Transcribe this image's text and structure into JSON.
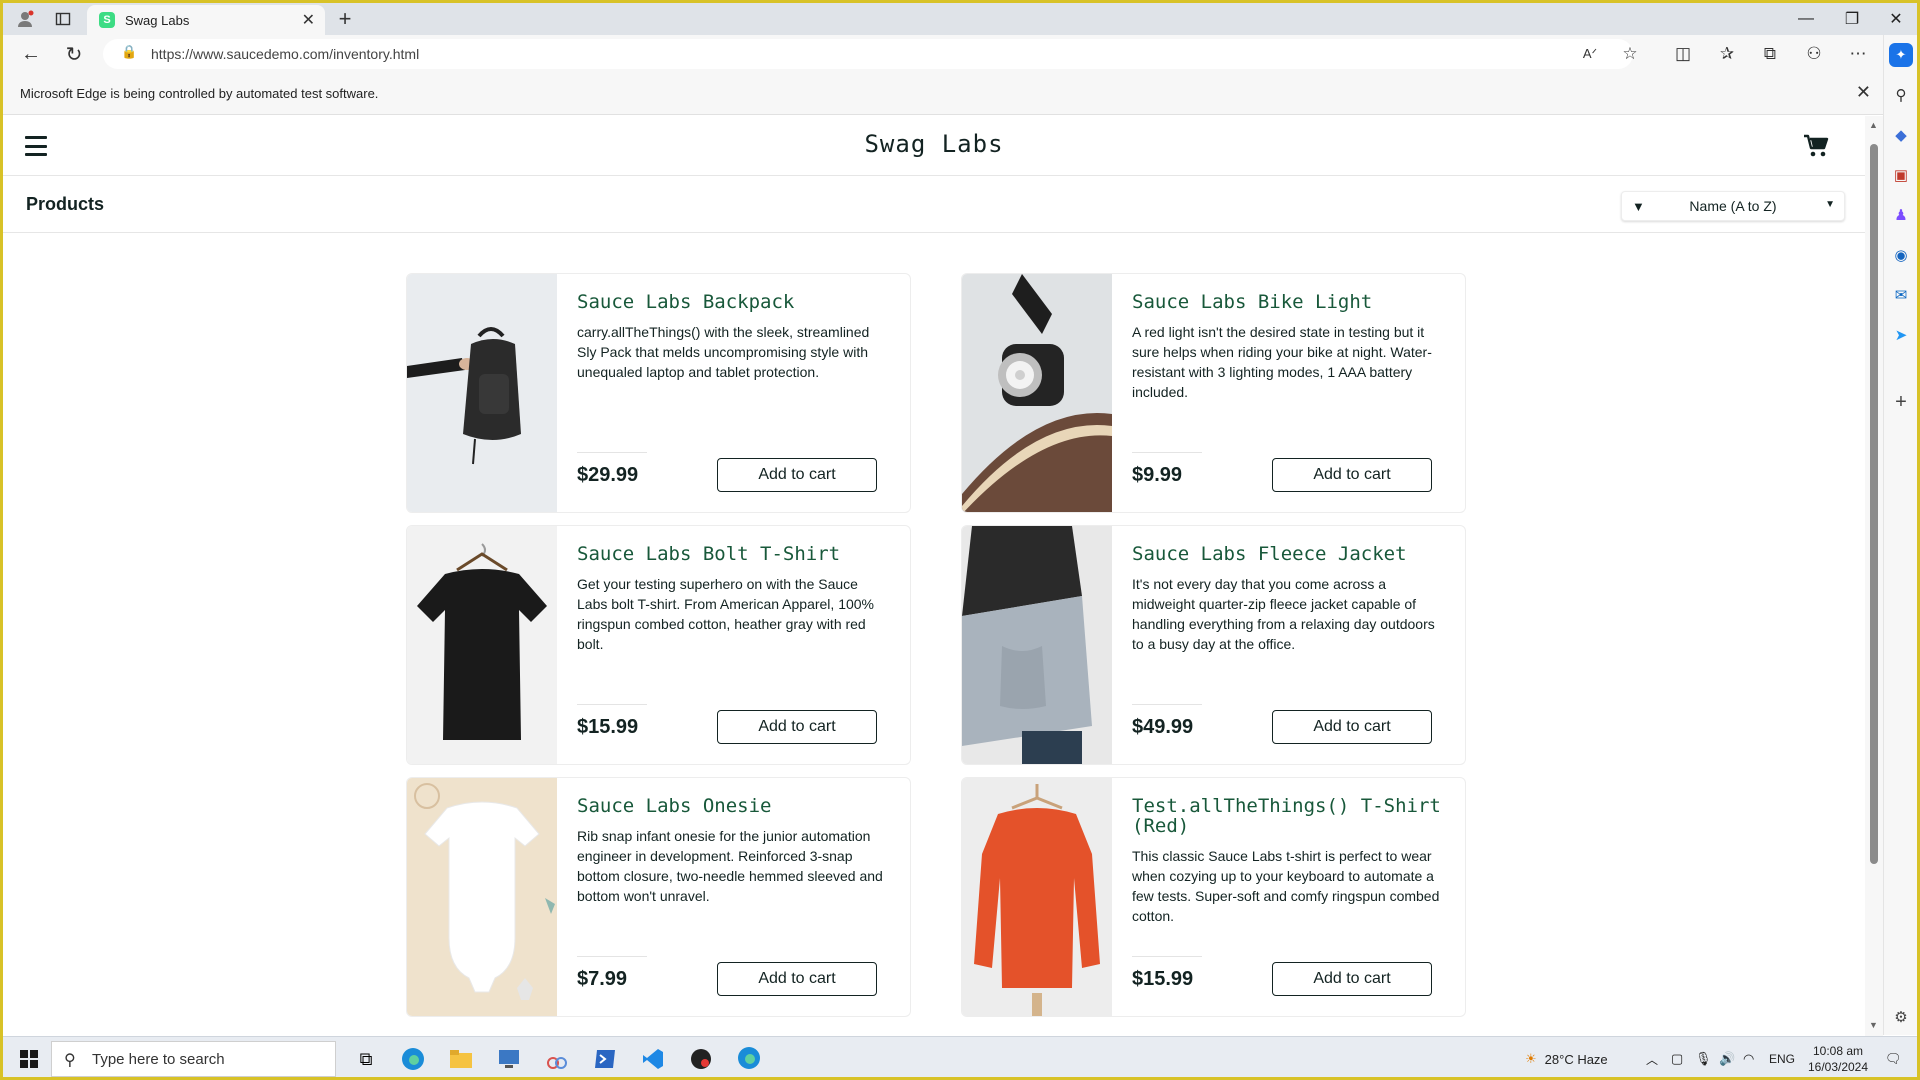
{
  "browser": {
    "tab_title": "Swag Labs",
    "url": "https://www.saucedemo.com/inventory.html",
    "automation_notice": "Microsoft Edge is being controlled by automated test software.",
    "favicon_letter": "S"
  },
  "app": {
    "logo": "Swag Labs",
    "page_title": "Products",
    "sort_selected": "Name (A to Z)"
  },
  "products": [
    {
      "name": "Sauce Labs Backpack",
      "description": "carry.allTheThings() with the sleek, streamlined Sly Pack that melds uncompromising style with unequaled laptop and tablet protection.",
      "price": "$29.99",
      "button": "Add to cart"
    },
    {
      "name": "Sauce Labs Bike Light",
      "description": "A red light isn't the desired state in testing but it sure helps when riding your bike at night. Water-resistant with 3 lighting modes, 1 AAA battery included.",
      "price": "$9.99",
      "button": "Add to cart"
    },
    {
      "name": "Sauce Labs Bolt T-Shirt",
      "description": "Get your testing superhero on with the Sauce Labs bolt T-shirt. From American Apparel, 100% ringspun combed cotton, heather gray with red bolt.",
      "price": "$15.99",
      "button": "Add to cart"
    },
    {
      "name": "Sauce Labs Fleece Jacket",
      "description": "It's not every day that you come across a midweight quarter-zip fleece jacket capable of handling everything from a relaxing day outdoors to a busy day at the office.",
      "price": "$49.99",
      "button": "Add to cart"
    },
    {
      "name": "Sauce Labs Onesie",
      "description": "Rib snap infant onesie for the junior automation engineer in development. Reinforced 3-snap bottom closure, two-needle hemmed sleeved and bottom won't unravel.",
      "price": "$7.99",
      "button": "Add to cart"
    },
    {
      "name": "Test.allTheThings() T-Shirt (Red)",
      "description": "This classic Sauce Labs t-shirt is perfect to wear when cozying up to your keyboard to automate a few tests. Super-soft and comfy ringspun combed cotton.",
      "price": "$15.99",
      "button": "Add to cart"
    }
  ],
  "taskbar": {
    "search_placeholder": "Type here to search",
    "weather": "28°C  Haze",
    "language": "ENG",
    "time": "10:08 am",
    "date": "16/03/2024"
  },
  "colors": {
    "brand_green": "#18583a",
    "text_dark": "#132322",
    "window_border": "#d8c227"
  }
}
